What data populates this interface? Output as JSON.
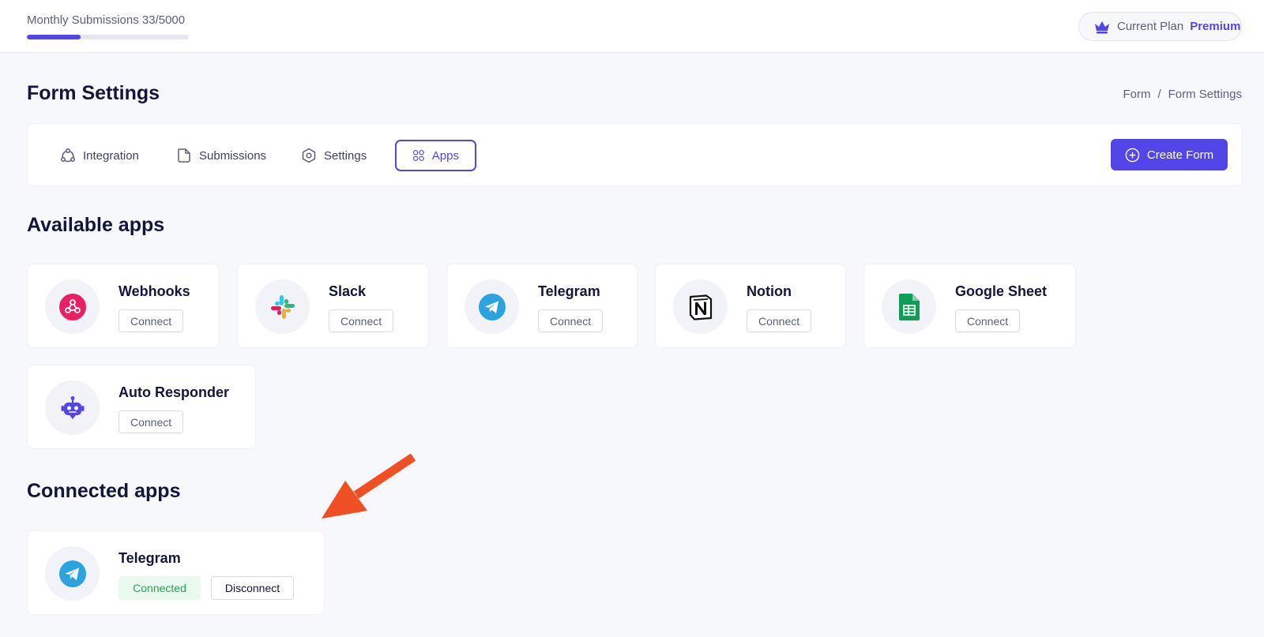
{
  "usage": {
    "label": "Monthly Submissions 33/5000",
    "fill_percent": 33
  },
  "plan": {
    "label": "Current Plan",
    "value": "Premium",
    "icon": "crown-icon"
  },
  "page": {
    "title": "Form Settings"
  },
  "breadcrumb": {
    "items": [
      "Form",
      "/",
      "Form Settings"
    ]
  },
  "tabs": [
    {
      "label": "Integration",
      "icon": "integration-icon",
      "active": false
    },
    {
      "label": "Submissions",
      "icon": "document-icon",
      "active": false
    },
    {
      "label": "Settings",
      "icon": "settings-icon",
      "active": false
    },
    {
      "label": "Apps",
      "icon": "apps-grid-icon",
      "active": true
    }
  ],
  "create_button": {
    "label": "Create Form",
    "icon": "plus-circle-icon"
  },
  "available": {
    "title": "Available apps",
    "apps": [
      {
        "name": "Webhooks",
        "action": "Connect",
        "icon": "webhooks-icon"
      },
      {
        "name": "Slack",
        "action": "Connect",
        "icon": "slack-icon"
      },
      {
        "name": "Telegram",
        "action": "Connect",
        "icon": "telegram-icon"
      },
      {
        "name": "Notion",
        "action": "Connect",
        "icon": "notion-icon"
      },
      {
        "name": "Google Sheet",
        "action": "Connect",
        "icon": "google-sheet-icon"
      },
      {
        "name": "Auto Responder",
        "action": "Connect",
        "icon": "robot-icon"
      }
    ]
  },
  "connected": {
    "title": "Connected apps",
    "apps": [
      {
        "name": "Telegram",
        "status": "Connected",
        "action": "Disconnect",
        "icon": "telegram-icon"
      }
    ]
  },
  "colors": {
    "accent": "#5346e8",
    "webhooks": "#e91e63",
    "telegram": "#2aa3df",
    "sheets": "#0f9d58",
    "connected_text": "#22a653",
    "annotation_arrow": "#f04e23"
  }
}
